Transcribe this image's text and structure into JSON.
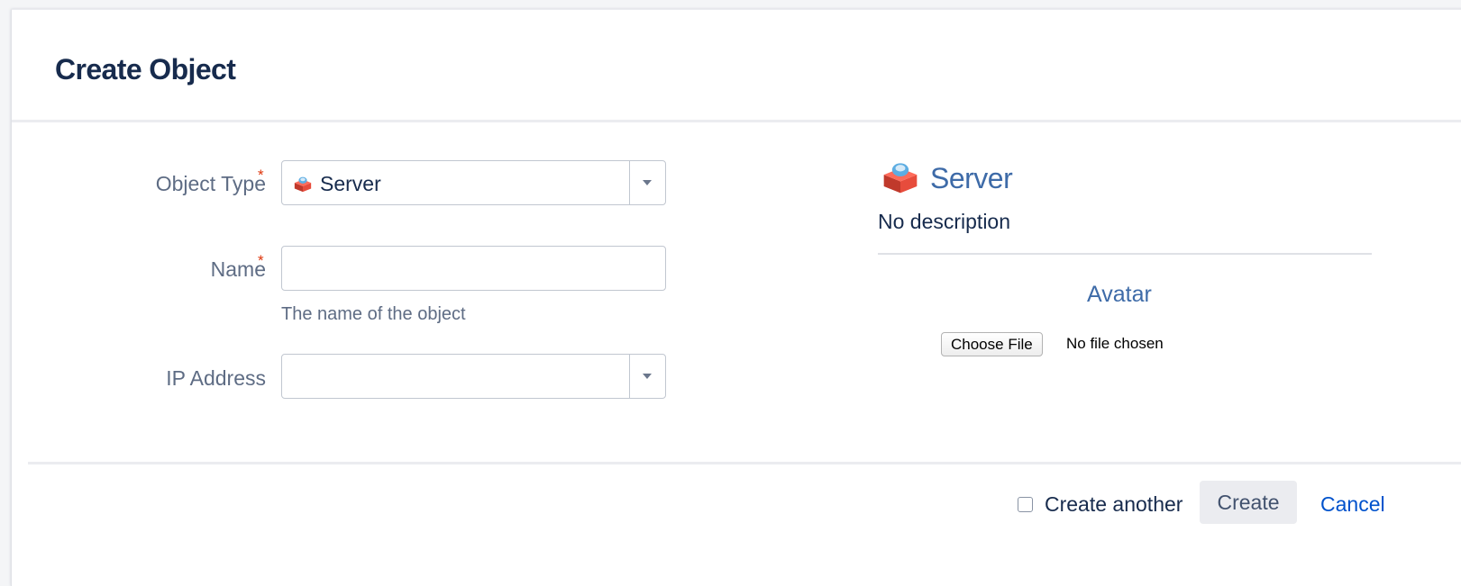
{
  "dialog": {
    "title": "Create Object"
  },
  "form": {
    "object_type": {
      "label": "Object Type",
      "required_marker": "*",
      "value": "Server",
      "value_icon": "server-box-icon"
    },
    "name": {
      "label": "Name",
      "required_marker": "*",
      "value": "",
      "help": "The name of the object"
    },
    "ip_address": {
      "label": "IP Address",
      "value": ""
    }
  },
  "preview": {
    "icon": "server-box-icon",
    "title": "Server",
    "description": "No description",
    "avatar_title": "Avatar",
    "choose_file_label": "Choose File",
    "no_file_text": "No file chosen"
  },
  "footer": {
    "create_another_label": "Create another",
    "create_another_checked": false,
    "create_label": "Create",
    "cancel_label": "Cancel"
  },
  "colors": {
    "title_text": "#172b4d",
    "link_blue": "#0052cc",
    "preview_blue": "#3e6ba8",
    "required_red": "#de350b",
    "label_gray": "#5e6c84"
  }
}
